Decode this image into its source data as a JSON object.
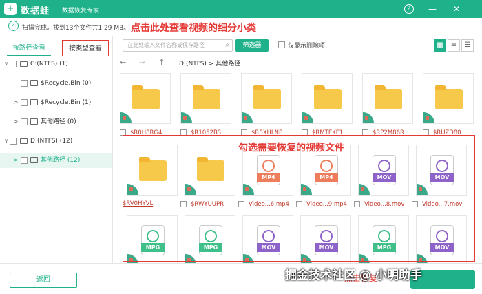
{
  "app": {
    "logo_char": "+",
    "name": "数据蛙",
    "subtitle": "数据恢复专家"
  },
  "window": {
    "help_icon": "?",
    "min_icon": "—",
    "close_icon": "✕"
  },
  "status": {
    "text": "扫描完成。找到13个文件共1.29 MB。"
  },
  "annotations": {
    "top": "点击此处查看视频的细分小类",
    "middle": "勾选需要恢复的视频文件",
    "bottom_partial": "点击恢复"
  },
  "sidebar": {
    "tab_path": "按路径查看",
    "tab_type": "按类型查看",
    "tree": [
      {
        "label": "C:(NTFS) (1)",
        "expand": "∨",
        "type": "drive"
      },
      {
        "label": "$Recycle.Bin (0)",
        "expand": "",
        "type": "folder"
      },
      {
        "label": "$Recycle.Bin (1)",
        "expand": ">",
        "type": "folder"
      },
      {
        "label": "其他路径 (0)",
        "expand": ">",
        "type": "folder"
      },
      {
        "label": "D:(NTFS) (12)",
        "expand": "∨",
        "type": "drive"
      },
      {
        "label": "其他路径 (12)",
        "expand": ">",
        "type": "folder"
      }
    ]
  },
  "toolbar": {
    "search_placeholder": "在此处输入文件名称或保存路径",
    "filter_label": "筛选器",
    "only_deleted_label": "仅显示删除项"
  },
  "nav": {
    "back": "←",
    "forward": "→",
    "up": "↑",
    "path": "D:(NTFS) > 其他路径"
  },
  "files": [
    {
      "name": "$R0H8RG4",
      "kind": "folder"
    },
    {
      "name": "$R1052BS",
      "kind": "folder"
    },
    {
      "name": "$R8XHLNP",
      "kind": "folder"
    },
    {
      "name": "$RMTEKF1",
      "kind": "folder"
    },
    {
      "name": "$RP2M86R",
      "kind": "folder"
    },
    {
      "name": "$RUZD80",
      "kind": "folder"
    },
    {
      "name": "$RV0HYVL",
      "kind": "folder"
    },
    {
      "name": "$RWYUUPR",
      "kind": "folder"
    },
    {
      "name": "Video...6.mp4",
      "kind": "MP4"
    },
    {
      "name": "Video...9.mp4",
      "kind": "MP4"
    },
    {
      "name": "Video...8.mov",
      "kind": "MOV"
    },
    {
      "name": "Video...7.mov",
      "kind": "MOV"
    },
    {
      "name": "",
      "kind": "MPG"
    },
    {
      "name": "",
      "kind": "MPG"
    },
    {
      "name": "",
      "kind": "MOV"
    },
    {
      "name": "",
      "kind": "MOV"
    },
    {
      "name": "",
      "kind": "MPG"
    },
    {
      "name": "",
      "kind": "MOV"
    }
  ],
  "colors": {
    "accent": "#1fb28a",
    "annotation": "#e53935",
    "mp4": "#ee7d5c",
    "mov": "#8e63c9",
    "mpg": "#3fbf8a"
  },
  "bottom": {
    "back_label": "返回"
  },
  "watermark": {
    "text": "掘金技术社区 @ 小明助手"
  }
}
